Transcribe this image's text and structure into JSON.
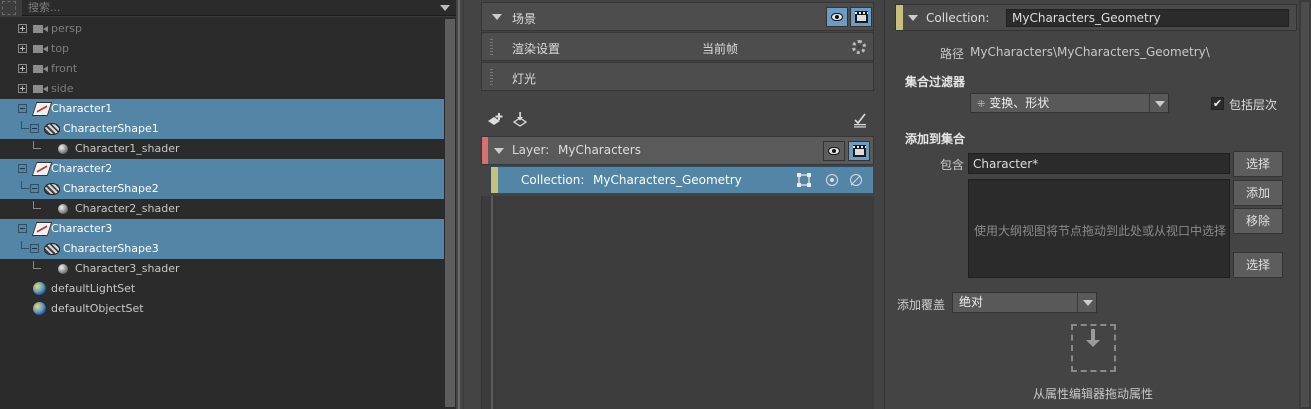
{
  "outliner": {
    "search_placeholder": "搜索...",
    "items": [
      {
        "label": "persp"
      },
      {
        "label": "top"
      },
      {
        "label": "front"
      },
      {
        "label": "side"
      },
      {
        "label": "Character1"
      },
      {
        "label": "CharacterShape1"
      },
      {
        "label": "Character1_shader"
      },
      {
        "label": "Character2"
      },
      {
        "label": "CharacterShape2"
      },
      {
        "label": "Character2_shader"
      },
      {
        "label": "Character3"
      },
      {
        "label": "CharacterShape3"
      },
      {
        "label": "Character3_shader"
      },
      {
        "label": "defaultLightSet"
      },
      {
        "label": "defaultObjectSet"
      }
    ]
  },
  "render_setup": {
    "scene_label": "场景",
    "render_settings_label": "渲染设置",
    "current_frame_label": "当前帧",
    "lights_label": "灯光",
    "layer_prefix": "Layer:",
    "layer_name": "MyCharacters",
    "collection_prefix": "Collection:",
    "collection_name": "MyCharacters_Geometry"
  },
  "property_editor": {
    "header_prefix": "Collection:",
    "name_value": "MyCharacters_Geometry",
    "path_label": "路径",
    "path_value": "MyCharacters\\MyCharacters_Geometry\\",
    "filter_section": "集合过滤器",
    "filter_value": "变换、形状",
    "include_hierarchy_label": "包括层次",
    "include_hierarchy_checked": "✔",
    "add_to_collection_section": "添加到集合",
    "include_label": "包含",
    "include_value": "Character*",
    "select_button": "选择",
    "add_button": "添加",
    "remove_button": "移除",
    "select_button_2": "选择",
    "drop_hint": "使用大纲视图将节点拖动到此处或从视口中选择",
    "add_override_label": "添加覆盖",
    "override_value": "绝对",
    "attr_drag_hint": "从属性编辑器拖动属性"
  },
  "colors": {
    "selection": "#5285a6",
    "panel": "#444444",
    "dark": "#2b2b2b",
    "layer_accent": "#d77070",
    "collection_accent": "#c8c07a",
    "toggle_on": "#6b9cc4"
  }
}
